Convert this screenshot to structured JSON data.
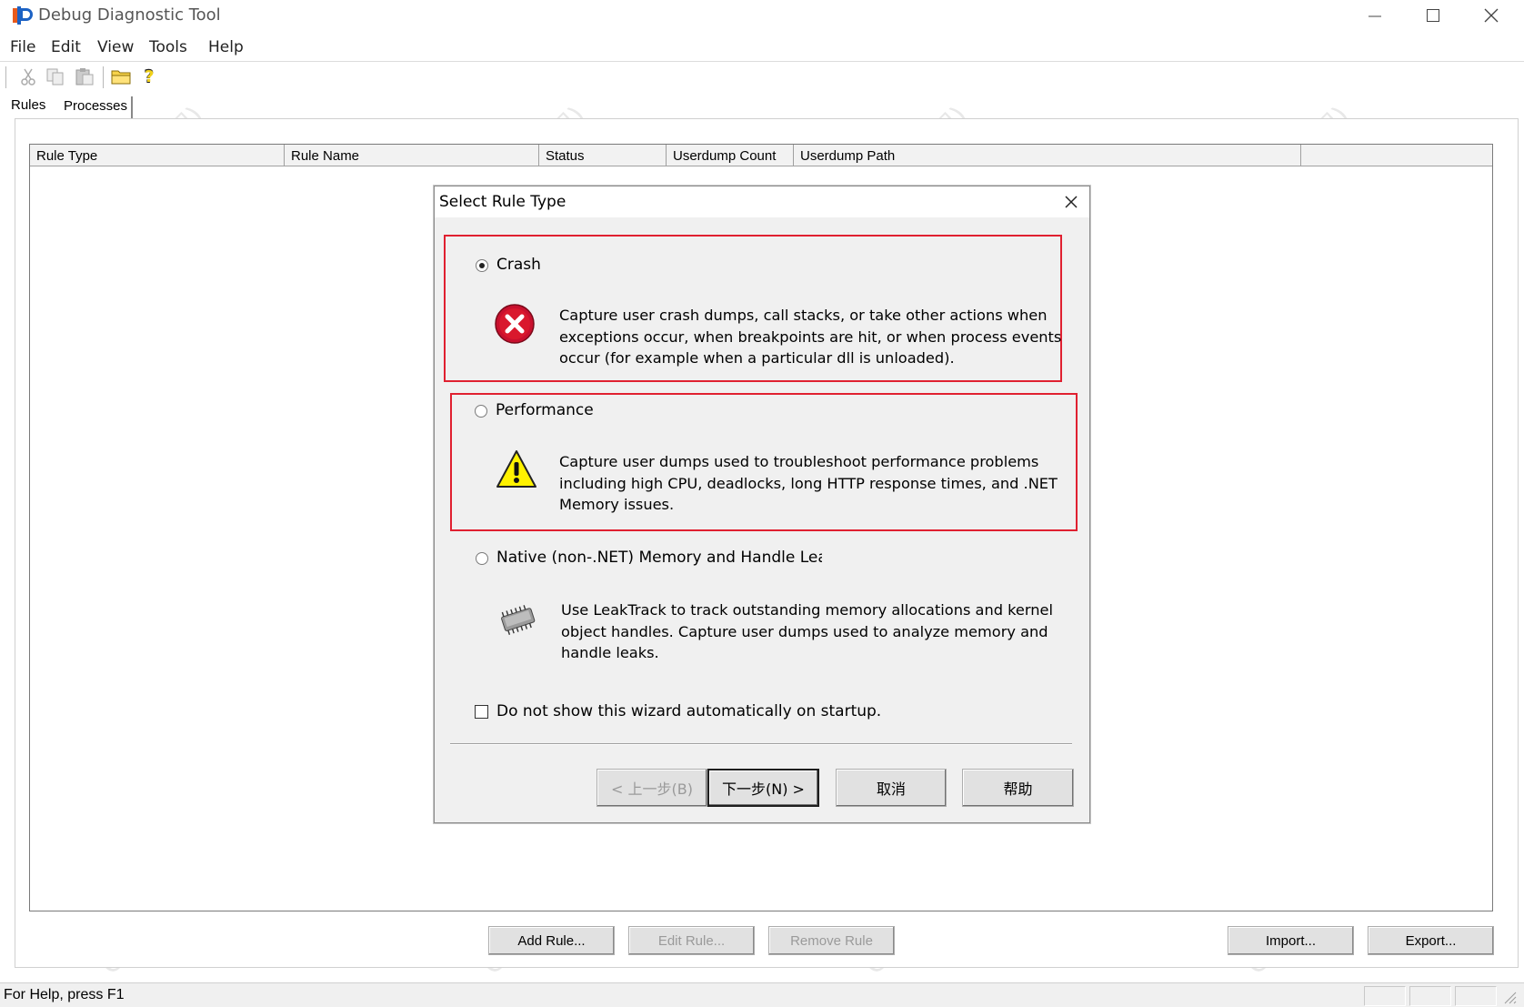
{
  "window": {
    "title": "Debug Diagnostic Tool",
    "controls": {
      "minimize": "minimize-icon",
      "maximize": "maximize-icon",
      "close": "close-icon"
    }
  },
  "menu": [
    "File",
    "Edit",
    "View",
    "Tools",
    "Help"
  ],
  "toolbar": {
    "icons": [
      "cut-icon",
      "copy-icon",
      "paste-icon",
      "open-folder-icon",
      "help-icon"
    ]
  },
  "tabs": [
    {
      "label": "Rules",
      "active": true
    },
    {
      "label": "Processes",
      "active": false
    }
  ],
  "rules_table": {
    "columns": [
      "Rule Type",
      "Rule Name",
      "Status",
      "Userdump Count",
      "Userdump Path"
    ],
    "rows": []
  },
  "bottom_buttons": {
    "add_rule": "Add Rule...",
    "edit_rule": "Edit Rule...",
    "remove_rule": "Remove Rule",
    "import": "Import...",
    "export": "Export..."
  },
  "status_bar": {
    "text": "For Help, press F1"
  },
  "dialog": {
    "title": "Select Rule Type",
    "options": [
      {
        "label": "Crash",
        "selected": true,
        "icon": "error-icon",
        "description": "Capture user crash dumps, call stacks, or take other actions when exceptions occur, when breakpoints are hit, or when process events occur (for example when a particular dll is unloaded)."
      },
      {
        "label": "Performance",
        "selected": false,
        "icon": "warning-icon",
        "description": "Capture user dumps used to troubleshoot performance problems including high CPU, deadlocks, long HTTP response times, and .NET Memory issues."
      },
      {
        "label": "Native (non-.NET) Memory and Handle Leak",
        "selected": false,
        "icon": "memory-chip-icon",
        "description": "Use LeakTrack to track outstanding memory allocations and kernel object handles. Capture user dumps used to analyze memory and handle leaks."
      }
    ],
    "checkbox": {
      "label": "Do not show this wizard automatically on startup.",
      "checked": false
    },
    "buttons": {
      "back": "< 上一步(B)",
      "next": "下一步(N) >",
      "cancel": "取消",
      "help": "帮助"
    }
  },
  "colors": {
    "highlight_border": "#e02030",
    "dialog_bg": "#f0f0f0"
  },
  "watermark": "CTO(玄胡)"
}
